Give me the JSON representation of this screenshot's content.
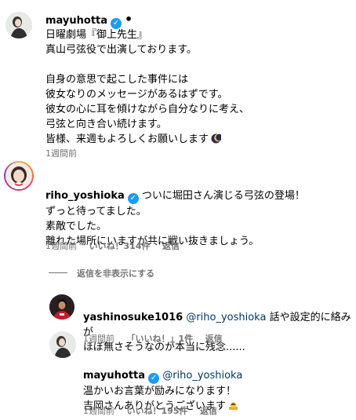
{
  "colors": {
    "verified": "#1d9bf0",
    "mention": "#00376b",
    "meta": "#737373"
  },
  "post": {
    "username": "mayuhotta",
    "separator": "•",
    "caption": "日曜劇場『御上先生』\n真山弓弦役で出演しております。\n\n自身の意思で起こした事件には\n彼女なりのメッセージがあるはずです。\n彼女の心に耳を傾けながら自分なりに考え、\n弓弦と向き合い続けます。\n皆様、来週もよろしくお願いします",
    "caption_emoji": "crescent-moon",
    "time": "1週間前"
  },
  "comments": [
    {
      "username": "riho_yoshioka",
      "text": "ついに堀田さん演じる弓弦の登場！\nずっと待ってました。\n素敵でした。\n離れた場所にいますが共に戦い抜きましょう。",
      "time": "1週間前",
      "likes": "いいね！314件",
      "reply": "返信",
      "hide_replies": "返信を非表示にする"
    }
  ],
  "replies": [
    {
      "username": "yashinosuke1016",
      "mention": "@riho_yoshioka",
      "text_line1": "話や設定的に絡みが",
      "text_line2": "ほぼ無さそうなのが本当に残念......",
      "time": "1週間前",
      "likes": "「いいね！」1件",
      "reply": "返信"
    },
    {
      "username": "mayuhotta",
      "mention": "@riho_yoshioka",
      "text": "温かいお言葉が励みになります！\n吉岡さんありがとうございます",
      "emoji": "bowing-person",
      "time": "1週間前",
      "likes": "いいね！195件",
      "reply": "返信"
    }
  ]
}
